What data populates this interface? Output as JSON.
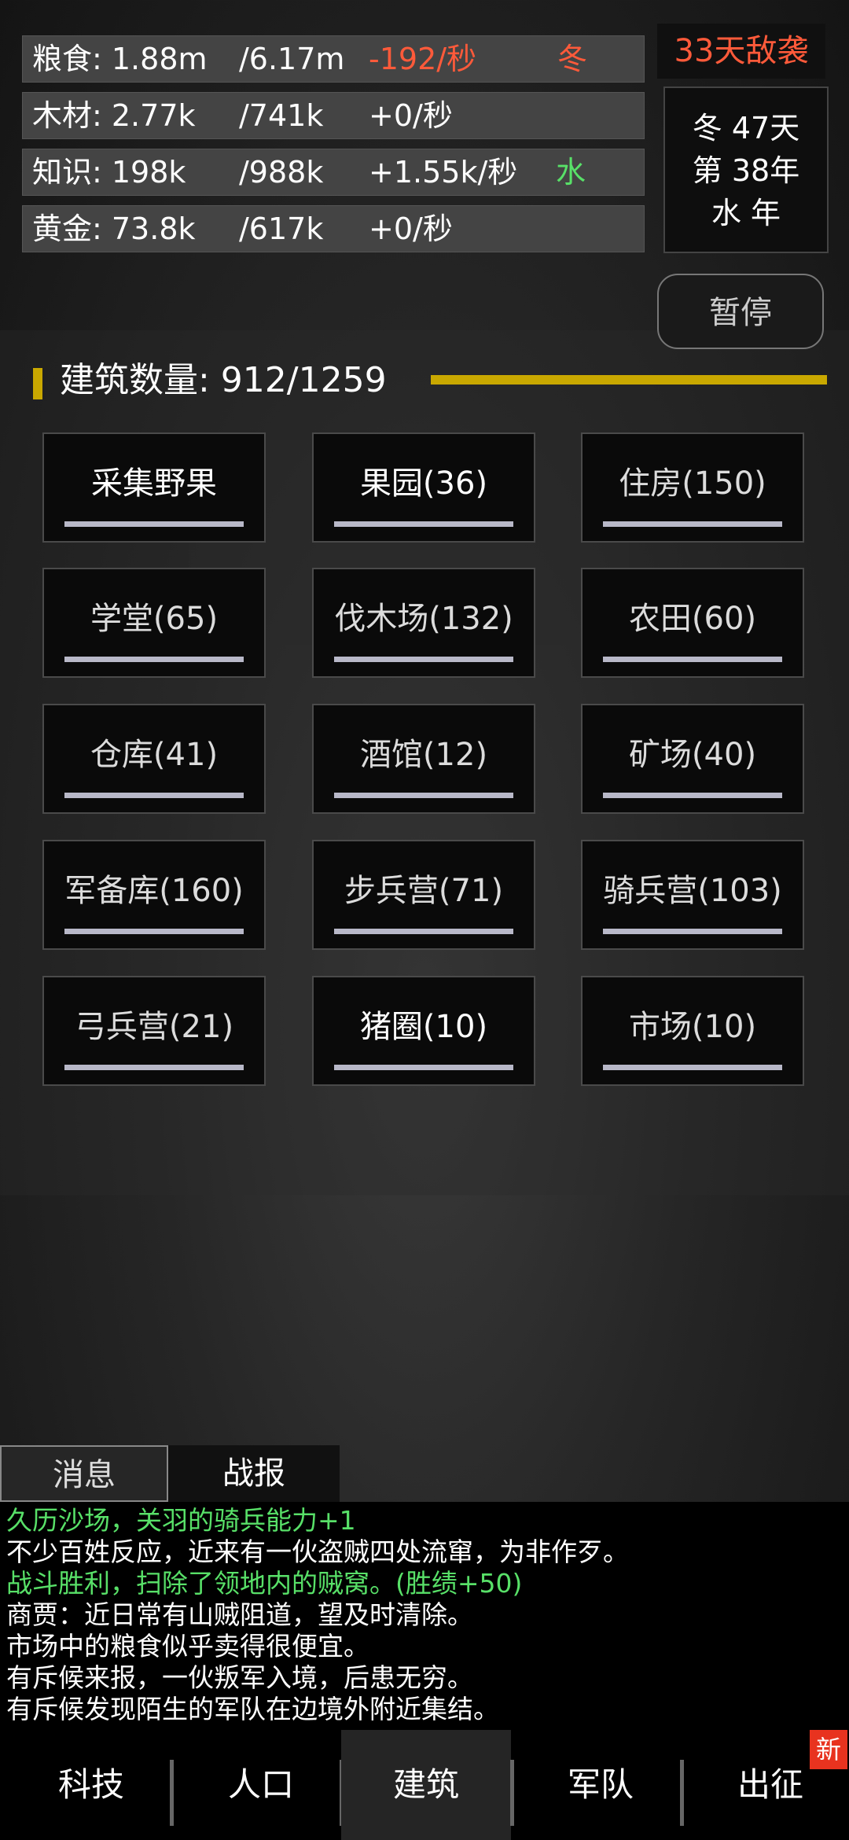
{
  "resources": [
    {
      "name": "粮食: 1.88m",
      "cap": "/6.17m",
      "rate": "-192/秒",
      "extra": "冬",
      "rate_color": "#ff5a3a",
      "extra_color": "#ff5a3a"
    },
    {
      "name": "木材: 2.77k",
      "cap": "/741k",
      "rate": "+0/秒",
      "extra": "",
      "rate_color": "#ffffff",
      "extra_color": "#ffffff"
    },
    {
      "name": "知识: 198k",
      "cap": "/988k",
      "rate": "+1.55k/秒",
      "extra": "水",
      "rate_color": "#ffffff",
      "extra_color": "#58e068"
    },
    {
      "name": "黄金: 73.8k",
      "cap": "/617k",
      "rate": "+0/秒",
      "extra": "",
      "rate_color": "#ffffff",
      "extra_color": "#ffffff"
    }
  ],
  "enemy_countdown": "33天敌袭",
  "date": {
    "line1": "冬 47天",
    "line2": "第 38年",
    "line3": "水 年"
  },
  "pause_label": "暂停",
  "buildings_title": "建筑数量: 912/1259",
  "buildings": [
    {
      "label": "采集野果"
    },
    {
      "label": "果园(36)"
    },
    {
      "label": "住房(150)"
    },
    {
      "label": "学堂(65)"
    },
    {
      "label": "伐木场(132)"
    },
    {
      "label": "农田(60)"
    },
    {
      "label": "仓库(41)"
    },
    {
      "label": "酒馆(12)"
    },
    {
      "label": "矿场(40)"
    },
    {
      "label": "军备库(160)"
    },
    {
      "label": "步兵营(71)"
    },
    {
      "label": "骑兵营(103)"
    },
    {
      "label": "弓兵营(21)"
    },
    {
      "label": "猪圈(10)"
    },
    {
      "label": "市场(10)"
    }
  ],
  "tabs": {
    "messages": "消息",
    "battle": "战报"
  },
  "log": [
    {
      "text": "久历沙场，关羽的骑兵能力+1",
      "color": "#58e068"
    },
    {
      "text": "不少百姓反应，近来有一伙盗贼四处流窜，为非作歹。",
      "color": "#ffffff"
    },
    {
      "text": "战斗胜利，扫除了领地内的贼窝。(胜绩+50)",
      "color": "#58e068"
    },
    {
      "text": "商贾：近日常有山贼阻道，望及时清除。",
      "color": "#ffffff"
    },
    {
      "text": "市场中的粮食似乎卖得很便宜。",
      "color": "#ffffff"
    },
    {
      "text": "有斥候来报，一伙叛军入境，后患无穷。",
      "color": "#ffffff"
    },
    {
      "text": "有斥候发现陌生的军队在边境外附近集结。",
      "color": "#ffffff"
    }
  ],
  "nav": [
    {
      "label": "科技"
    },
    {
      "label": "人口"
    },
    {
      "label": "建筑"
    },
    {
      "label": "军队"
    },
    {
      "label": "出征"
    }
  ],
  "nav_badge": "新",
  "colors": {
    "accent": "#c9a800",
    "alert": "#ff5a3a",
    "positive": "#58e068"
  }
}
